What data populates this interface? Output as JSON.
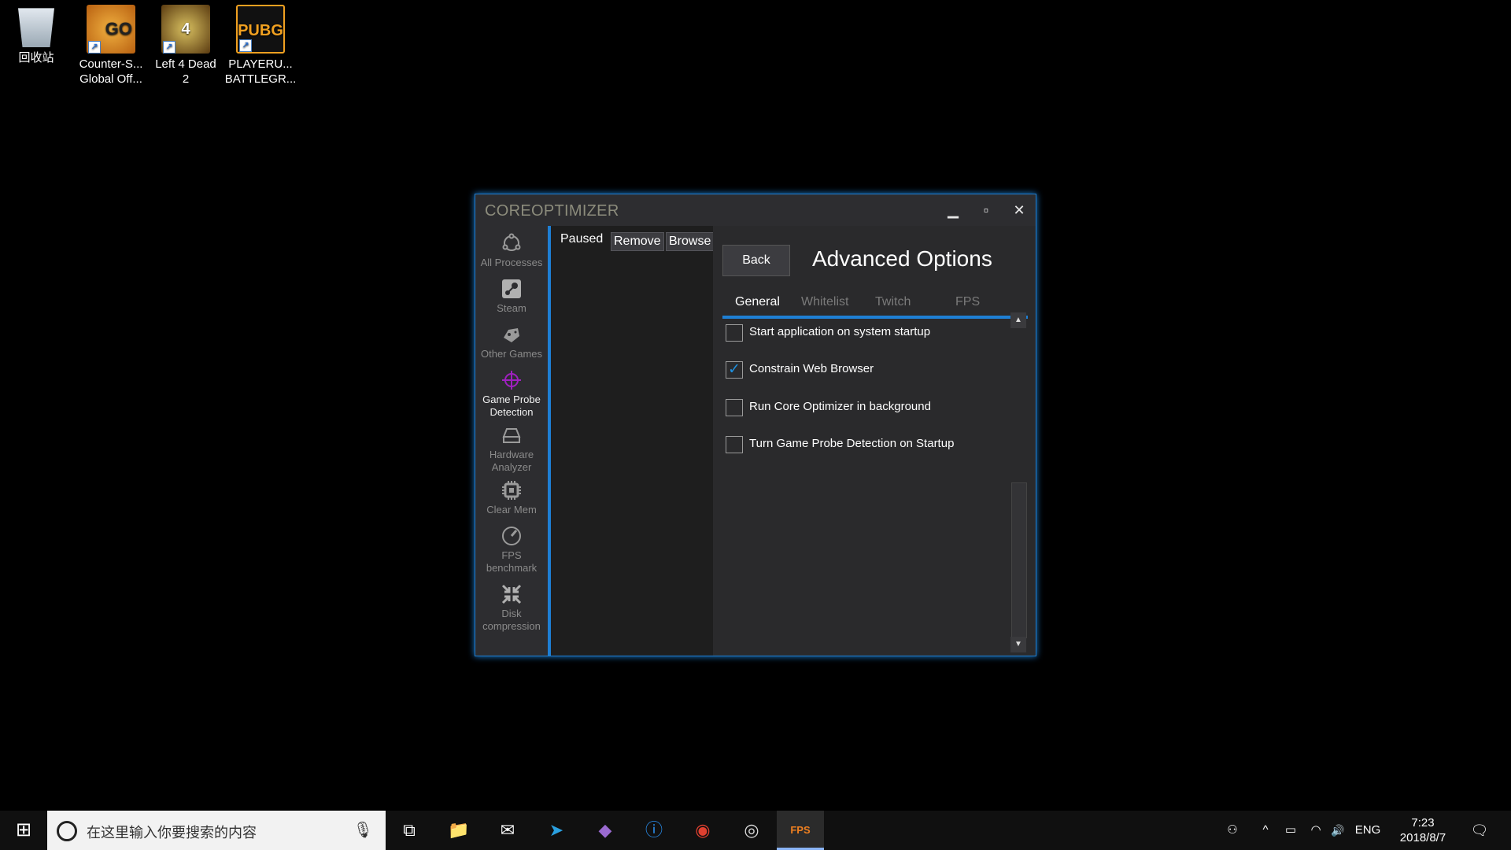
{
  "desktop": {
    "icons": [
      {
        "label1": "回收站",
        "label2": "",
        "icon": "recycle-bin-icon"
      },
      {
        "label1": "Counter-S...",
        "label2": "Global Off...",
        "icon": "csgo-icon",
        "badge": "GO"
      },
      {
        "label1": "Left 4 Dead",
        "label2": "2",
        "icon": "left4dead2-icon",
        "badge": "4"
      },
      {
        "label1": "PLAYERU...",
        "label2": "BATTLEGR...",
        "icon": "pubg-icon",
        "badge": "PUBG"
      }
    ]
  },
  "window": {
    "title": "COREOPTIMIZER",
    "controls": {
      "minimize": "▁",
      "maximize": "▫",
      "close": "✕"
    },
    "sidebar": [
      {
        "label": "All Processes",
        "icon": "processes-icon"
      },
      {
        "label": "Steam",
        "icon": "steam-icon"
      },
      {
        "label": "Other Games",
        "icon": "gamepad-icon"
      },
      {
        "label": "Game Probe Detection",
        "icon": "crosshair-icon",
        "active": true
      },
      {
        "label": "Hardware Analyzer",
        "icon": "hard-drive-icon"
      },
      {
        "label": "Clear Mem",
        "icon": "chip-icon"
      },
      {
        "label": "FPS benchmark",
        "icon": "speedometer-icon"
      },
      {
        "label": "Disk compression",
        "icon": "compress-icon"
      }
    ],
    "middle": {
      "status": "Paused",
      "remove": "Remove",
      "browse": "Browse"
    },
    "right": {
      "back": "Back",
      "title": "Advanced Options",
      "tabs": [
        "General",
        "Whitelist",
        "Twitch",
        "FPS"
      ],
      "active_tab": "General",
      "options": [
        {
          "label": "Start application on system startup",
          "checked": false
        },
        {
          "label": "Constrain Web Browser",
          "checked": true
        },
        {
          "label": "Run Core Optimizer in background",
          "checked": false
        },
        {
          "label": "Turn Game Probe Detection on Startup",
          "checked": false
        }
      ],
      "scroll_up": "▲",
      "scroll_down": "▼"
    },
    "accent": "#1e7fd4"
  },
  "taskbar": {
    "start": "⊞",
    "search_placeholder": "在这里输入你要搜索的内容",
    "mic": "🎙",
    "apps": [
      {
        "name": "task-view",
        "glyph": "⧉"
      },
      {
        "name": "file-explorer",
        "glyph": "📁"
      },
      {
        "name": "mail",
        "glyph": "✉"
      },
      {
        "name": "telegram",
        "glyph": "➤"
      },
      {
        "name": "visual-studio",
        "glyph": "◆"
      },
      {
        "name": "app-blue",
        "glyph": "ⓘ"
      },
      {
        "name": "chrome",
        "glyph": "◉"
      },
      {
        "name": "app-compass",
        "glyph": "◎"
      },
      {
        "name": "coreoptimizer",
        "glyph": "FPS"
      }
    ],
    "tray": {
      "people": "⚇",
      "chevron": "^",
      "battery": "▭",
      "wifi": "◠",
      "volume": "🔊",
      "lang": "ENG",
      "notifications": "🗨"
    },
    "time": "7:23",
    "date": "2018/8/7"
  }
}
